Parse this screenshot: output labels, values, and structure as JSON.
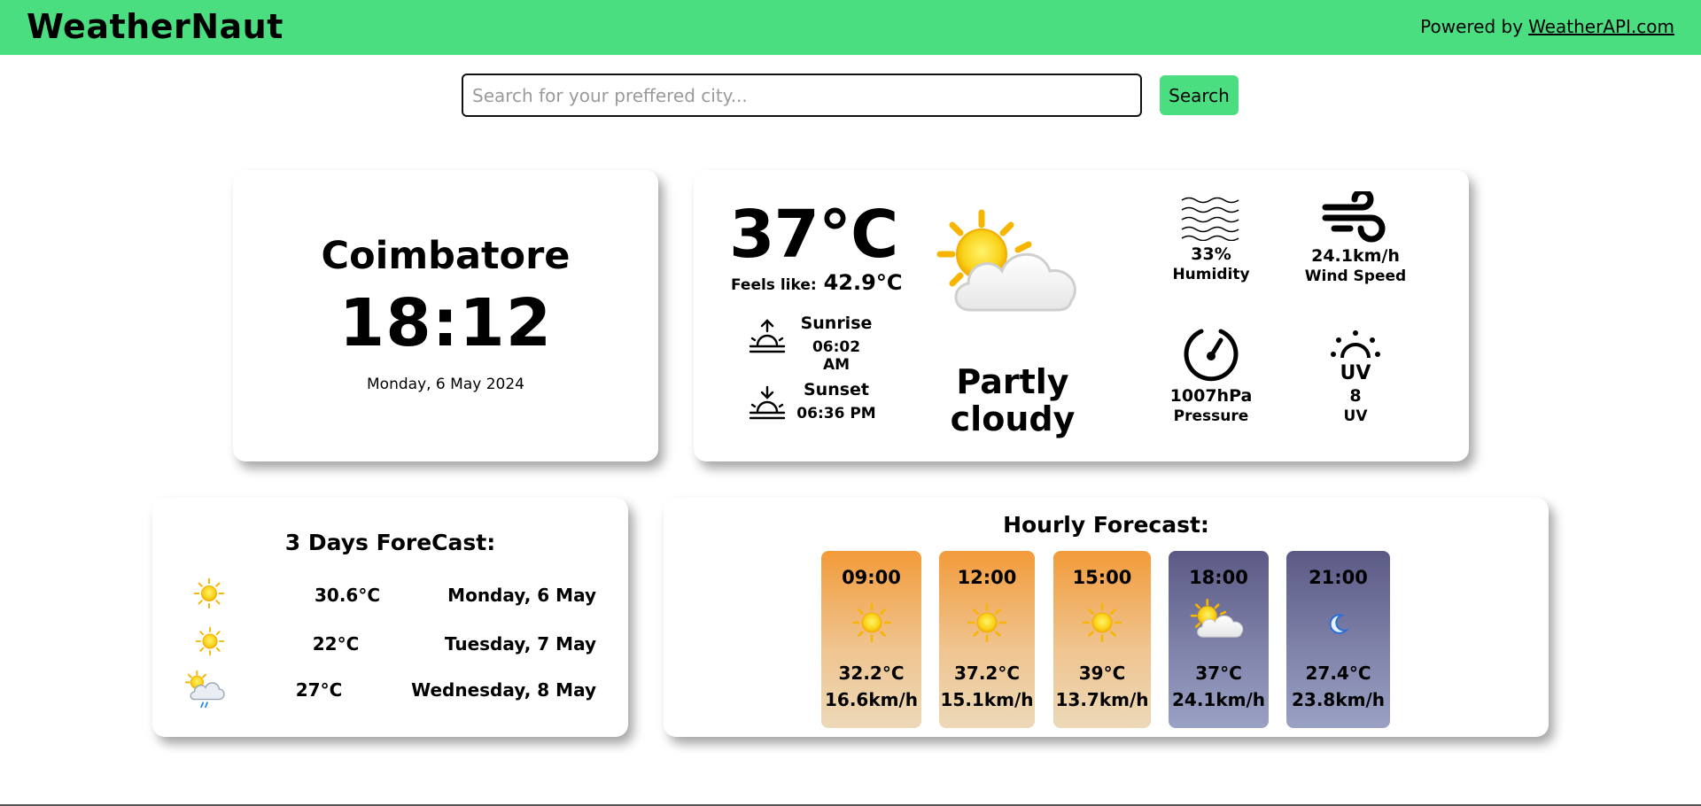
{
  "header": {
    "brand": "WeatherNaut",
    "powered_prefix": "Powered by",
    "powered_link": "WeatherAPI.com"
  },
  "search": {
    "placeholder": "Search for your preffered city...",
    "value": "",
    "button_label": "Search"
  },
  "location": {
    "city": "Coimbatore",
    "time": "18:12",
    "date": "Monday, 6 May 2024"
  },
  "current": {
    "temperature": "37°C",
    "feels_like_label": "Feels like:",
    "feels_like_value": "42.9°C",
    "sunrise_label": "Sunrise",
    "sunrise_time": "06:02 AM",
    "sunset_label": "Sunset",
    "sunset_time": "06:36 PM",
    "condition_line1": "Partly",
    "condition_line2": "cloudy",
    "condition_icon": "partly-cloudy-icon",
    "humidity_value": "33%",
    "humidity_label": "Humidity",
    "wind_value": "24.1km/h",
    "wind_label": "Wind Speed",
    "pressure_value": "1007hPa",
    "pressure_label": "Pressure",
    "uv_value": "8",
    "uv_label": "UV"
  },
  "daily": {
    "title": "3 Days ForeCast:",
    "days": [
      {
        "icon": "sunny-icon",
        "temp": "30.6°C",
        "date": "Monday, 6 May"
      },
      {
        "icon": "sunny-icon",
        "temp": "22°C",
        "date": "Tuesday, 7 May"
      },
      {
        "icon": "rain-shower-icon",
        "temp": "27°C",
        "date": "Wednesday, 8 May"
      }
    ]
  },
  "hourly": {
    "title": "Hourly Forecast:",
    "hours": [
      {
        "time": "09:00",
        "icon": "sunny-icon",
        "temp": "32.2°C",
        "wind": "16.6km/h",
        "period": "day"
      },
      {
        "time": "12:00",
        "icon": "sunny-icon",
        "temp": "37.2°C",
        "wind": "15.1km/h",
        "period": "day"
      },
      {
        "time": "15:00",
        "icon": "sunny-icon",
        "temp": "39°C",
        "wind": "13.7km/h",
        "period": "day"
      },
      {
        "time": "18:00",
        "icon": "partly-cloudy-icon",
        "temp": "37°C",
        "wind": "24.1km/h",
        "period": "night"
      },
      {
        "time": "21:00",
        "icon": "moon-icon",
        "temp": "27.4°C",
        "wind": "23.8km/h",
        "period": "night"
      }
    ]
  },
  "colors": {
    "accent": "#4ade80",
    "day_tile_top": "#f29b3a",
    "night_tile_top": "#5b5a86"
  }
}
